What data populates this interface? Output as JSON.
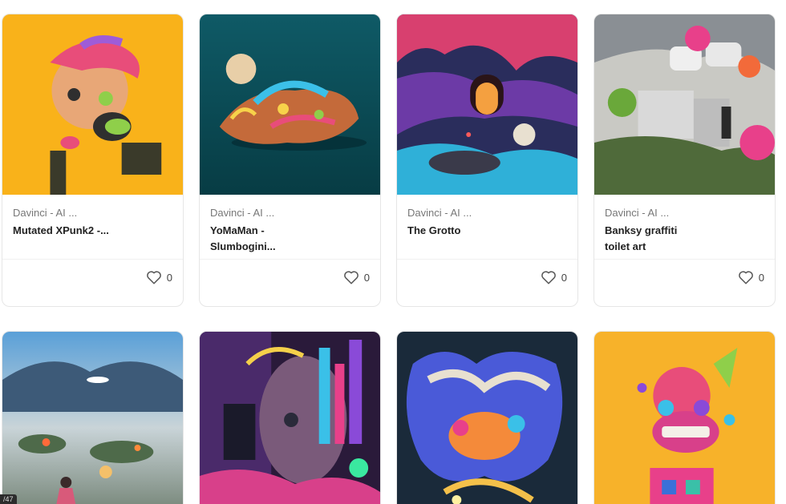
{
  "cards": [
    {
      "collection": "Davinci - AI ...",
      "title": "Mutated XPunk2 -...",
      "likes": "0"
    },
    {
      "collection": "Davinci - AI ...",
      "title": "YoMaMan - Slumbogini...",
      "likes": "0"
    },
    {
      "collection": "Davinci - AI ...",
      "title": "The Grotto",
      "likes": "0"
    },
    {
      "collection": "Davinci - AI ...",
      "title": "Banksy graffiti toilet art",
      "likes": "0"
    }
  ],
  "page_indicator": "/47",
  "colors": {
    "card_border": "#e6e6e6",
    "heart": "#555555",
    "collection_text": "#777777",
    "title_text": "#222222"
  },
  "icons": {
    "like": "heart-icon"
  }
}
